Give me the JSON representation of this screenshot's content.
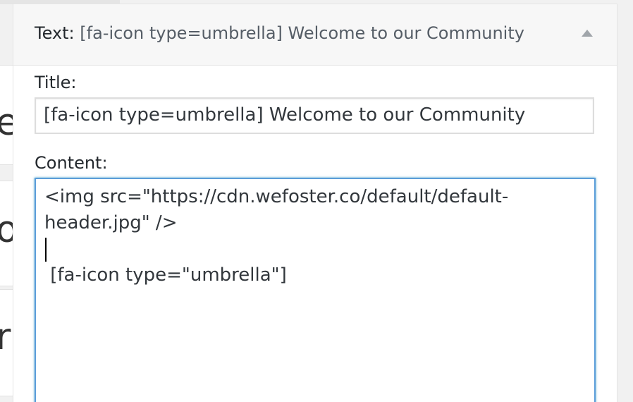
{
  "widget": {
    "title_prefix": "Text:",
    "title_suffix": "[fa-icon type=umbrella] Welcome to our Community",
    "toggle_icon": "arrow-up-icon"
  },
  "form": {
    "title_label": "Title:",
    "title_value": "[fa-icon type=umbrella] Welcome to our Community",
    "content_label": "Content:",
    "content_lines": [
      "<img src=\"https://cdn.wefoster.co/default/default-",
      "header.jpg\" />",
      "",
      " [fa-icon type=\"umbrella\"]"
    ]
  },
  "background": {
    "letters": [
      "e",
      "o",
      "r"
    ]
  }
}
